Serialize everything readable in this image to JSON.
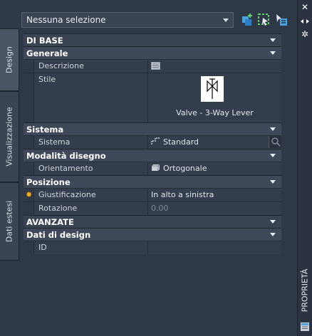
{
  "palette_title": "PROPRIETÀ",
  "tabs": [
    {
      "label": "Design",
      "active": true
    },
    {
      "label": "Visualizzazione",
      "active": false
    },
    {
      "label": "Dati estesi",
      "active": false
    }
  ],
  "selection": {
    "value": "Nessuna selezione"
  },
  "sections": {
    "di_base": "DI BASE",
    "generale": "Generale",
    "sistema": "Sistema",
    "modalita_disegno": "Modalità disegno",
    "posizione": "Posizione",
    "avanzate": "AVANZATE",
    "dati_di_design": "Dati di design"
  },
  "properties": {
    "descrizione": {
      "label": "Descrizione",
      "value": ""
    },
    "stile": {
      "label": "Stile",
      "value": "Valve - 3-Way Lever"
    },
    "sistema": {
      "label": "Sistema",
      "value": "Standard"
    },
    "orientamento": {
      "label": "Orientamento",
      "value": "Ortogonale"
    },
    "giustificazione": {
      "label": "Giustificazione",
      "value": "In alto a sinistra"
    },
    "rotazione": {
      "label": "Rotazione",
      "value": "0.00"
    },
    "id": {
      "label": "ID",
      "value": ""
    }
  },
  "colors": {
    "background": "#2f3846",
    "category": "#3f4858",
    "row": "#343d4b",
    "accent_star": "#f2b124"
  }
}
